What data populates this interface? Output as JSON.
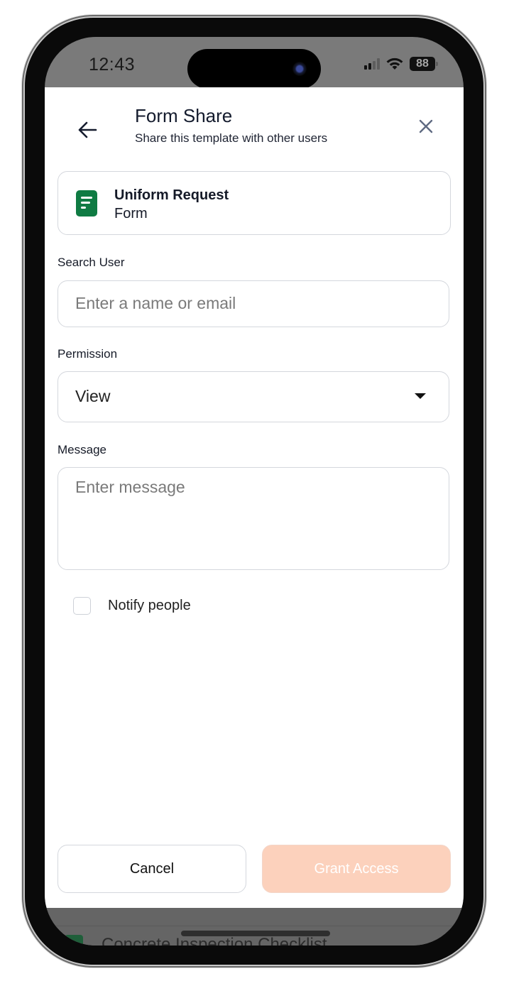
{
  "status_bar": {
    "time": "12:43",
    "battery_level": "88",
    "signal_bars_active": 2,
    "signal_bars_total": 4
  },
  "header": {
    "title": "Form Share",
    "subtitle": "Share this template with other users",
    "back_icon": "arrow-left-icon",
    "close_icon": "close-icon"
  },
  "template_card": {
    "name": "Uniform Request",
    "type": "Form",
    "icon": "form-document-icon",
    "icon_color": "#0f7b43"
  },
  "search_user": {
    "label": "Search User",
    "value": "",
    "placeholder": "Enter a name or email"
  },
  "permission": {
    "label": "Permission",
    "selected": "View"
  },
  "message": {
    "label": "Message",
    "value": "",
    "placeholder": "Enter message"
  },
  "notify": {
    "label": "Notify people",
    "checked": false
  },
  "actions": {
    "cancel_label": "Cancel",
    "grant_label": "Grant Access",
    "grant_color": "#fcd1bc"
  },
  "background_list": {
    "item_label": "Concrete Inspection Checklist"
  }
}
